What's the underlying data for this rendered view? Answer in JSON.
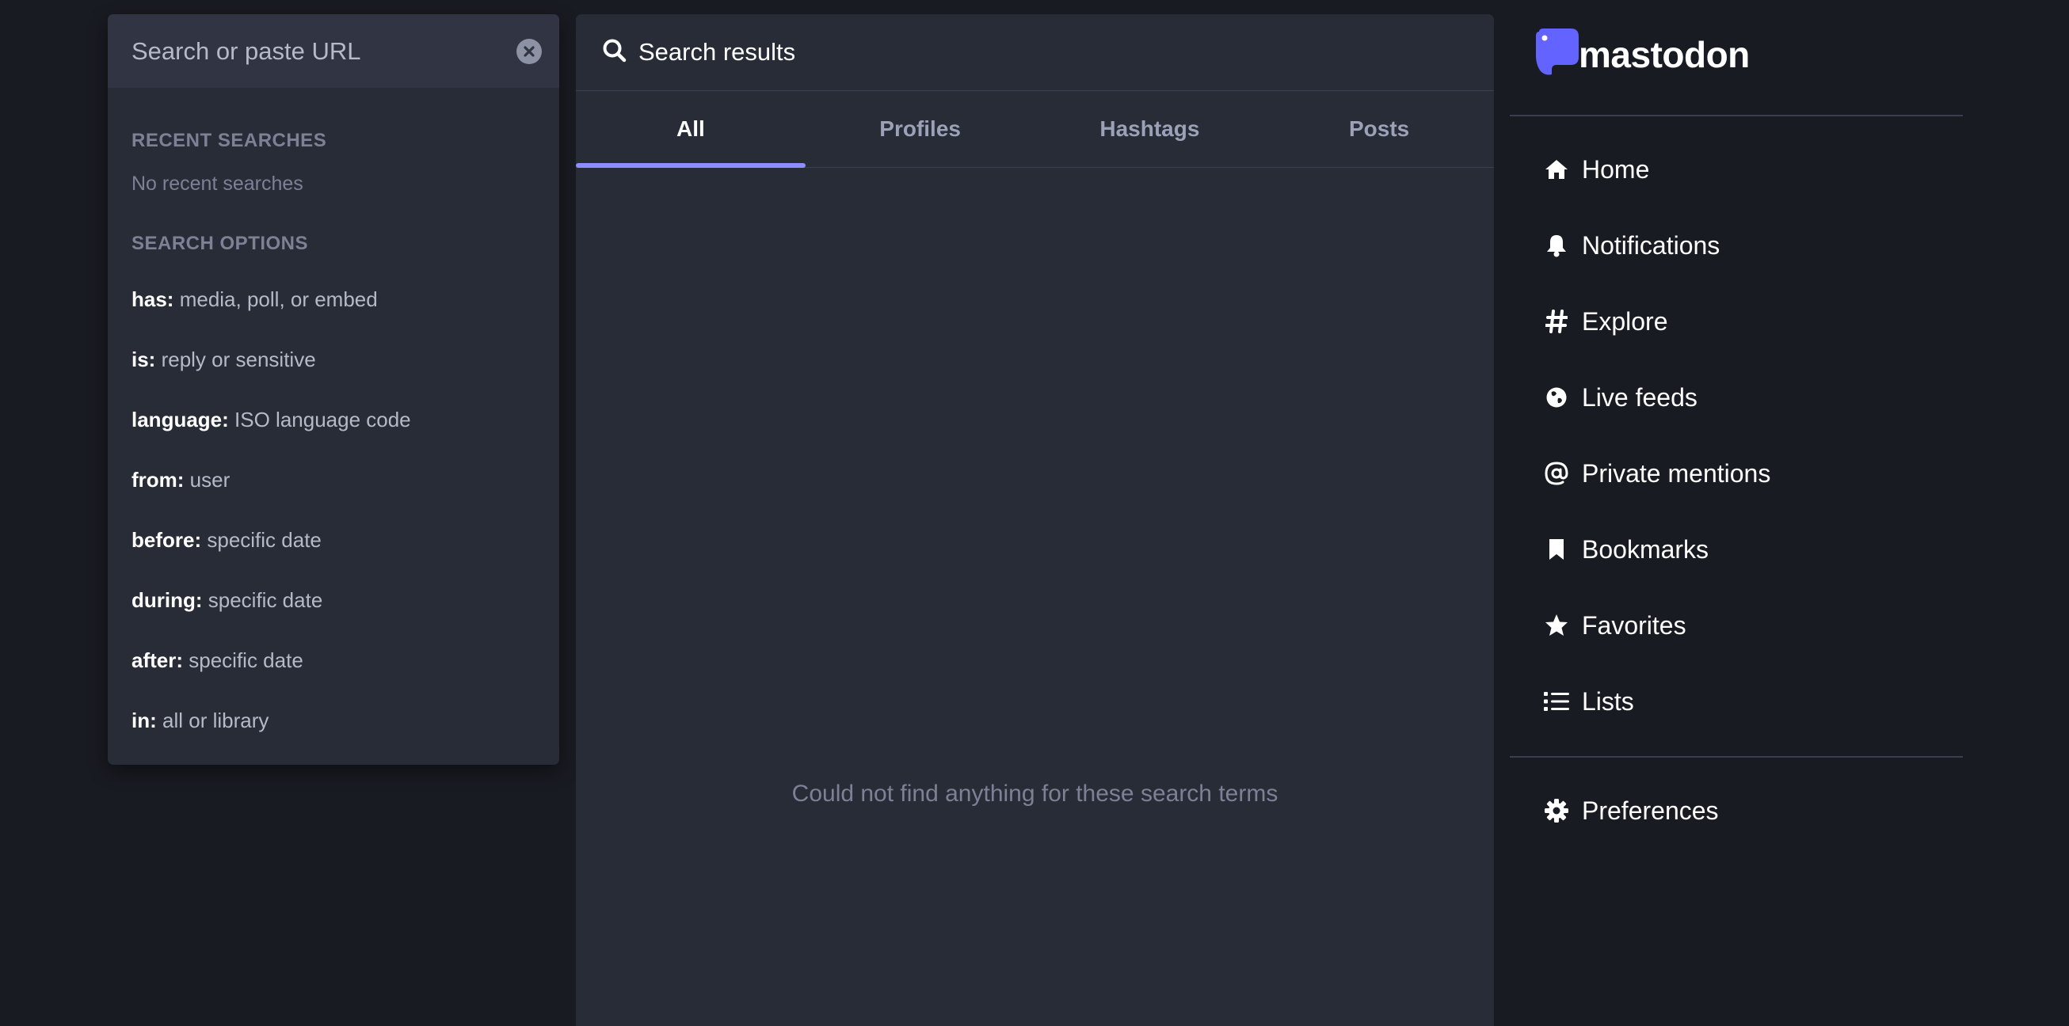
{
  "search": {
    "placeholder": "Search or paste URL",
    "recent_heading": "Recent searches",
    "recent_empty": "No recent searches",
    "options_heading": "Search options",
    "options": [
      {
        "key": "has:",
        "desc": "media, poll, or embed"
      },
      {
        "key": "is:",
        "desc": "reply or sensitive"
      },
      {
        "key": "language:",
        "desc": "ISO language code"
      },
      {
        "key": "from:",
        "desc": "user"
      },
      {
        "key": "before:",
        "desc": "specific date"
      },
      {
        "key": "during:",
        "desc": "specific date"
      },
      {
        "key": "after:",
        "desc": "specific date"
      },
      {
        "key": "in:",
        "desc": "all or library"
      }
    ]
  },
  "main": {
    "title": "Search results",
    "tabs": [
      {
        "label": "All",
        "active": true
      },
      {
        "label": "Profiles",
        "active": false
      },
      {
        "label": "Hashtags",
        "active": false
      },
      {
        "label": "Posts",
        "active": false
      }
    ],
    "empty_message": "Could not find anything for these search terms"
  },
  "nav": {
    "logo_text": "mastodon",
    "items": [
      {
        "label": "Home",
        "icon": "home-icon"
      },
      {
        "label": "Notifications",
        "icon": "bell-icon"
      },
      {
        "label": "Explore",
        "icon": "hashtag-icon"
      },
      {
        "label": "Live feeds",
        "icon": "globe-icon"
      },
      {
        "label": "Private mentions",
        "icon": "at-icon"
      },
      {
        "label": "Bookmarks",
        "icon": "bookmark-icon"
      },
      {
        "label": "Favorites",
        "icon": "star-icon"
      },
      {
        "label": "Lists",
        "icon": "list-icon"
      }
    ],
    "preferences": {
      "label": "Preferences",
      "icon": "gear-icon"
    }
  },
  "colors": {
    "background": "#191b22",
    "panel": "#282c37",
    "accent": "#8c8dff",
    "logo": "#6364ff"
  }
}
